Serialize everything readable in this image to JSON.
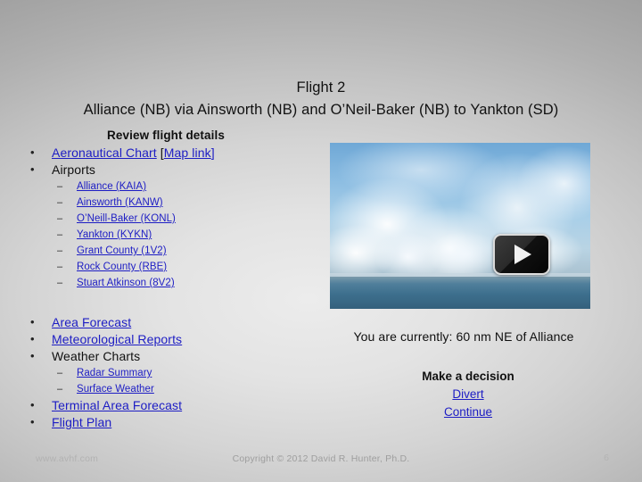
{
  "slide": {
    "title_line_1": "Flight 2",
    "title_line_2": "Alliance (NB) via Ainsworth (NB) and O’Neil-Baker (NB) to Yankton (SD)",
    "accent_link_color": "#1d1dc4",
    "text_color": "#101010"
  },
  "left": {
    "review_heading": "Review flight details",
    "group_a": [
      {
        "label": "Aeronautical Chart",
        "link": true,
        "suffix_open": " [",
        "suffix_link": "Map link",
        "suffix_close": "]"
      },
      {
        "label": "Airports",
        "link": false,
        "children": [
          "Alliance (KAIA)",
          "Ainsworth (KANW)",
          "O’Neill-Baker (KONL)",
          "Yankton (KYKN)",
          "Grant County (1V2)",
          "Rock County (RBE)",
          "Stuart Atkinson (8V2)"
        ]
      }
    ],
    "group_b": [
      {
        "label": "Area Forecast",
        "link": true
      },
      {
        "label": "Meteorological Reports",
        "link": true
      },
      {
        "label": "Weather Charts",
        "link": false,
        "children": [
          "Radar Summary",
          "Surface Weather"
        ]
      },
      {
        "label": "Terminal Area Forecast",
        "link": true
      },
      {
        "label": "Flight Plan",
        "link": true
      }
    ]
  },
  "right": {
    "video": {
      "caption": "video-thumbnail-clouds-over-ocean",
      "play_icon": "play-icon"
    },
    "position_label": "You are currently:",
    "position_value": "60 nm NE of Alliance",
    "position_line": "You are currently: 60 nm NE of Alliance",
    "decision_heading": "Make a decision",
    "decision_options": [
      "Divert",
      "Continue"
    ]
  },
  "footer": {
    "site": "www.avhf.com",
    "copyright": "Copyright © 2012 David R. Hunter, Ph.D.",
    "page_number": "6"
  }
}
